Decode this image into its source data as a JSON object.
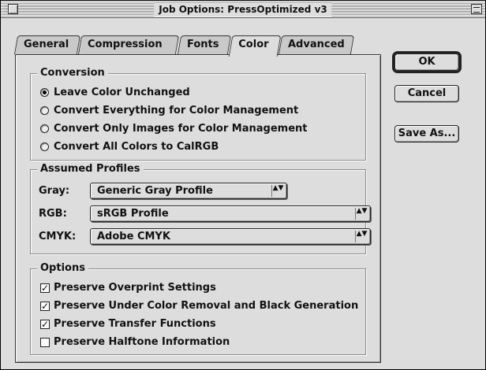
{
  "window": {
    "title": "Job Options: PressOptimized v3"
  },
  "tabs": [
    {
      "label": "General"
    },
    {
      "label": "Compression"
    },
    {
      "label": "Fonts"
    },
    {
      "label": "Color"
    },
    {
      "label": "Advanced"
    }
  ],
  "active_tab": "Color",
  "conversion": {
    "title": "Conversion",
    "options": [
      {
        "label": "Leave Color Unchanged",
        "selected": true
      },
      {
        "label": "Convert Everything for Color Management",
        "selected": false
      },
      {
        "label": "Convert Only Images for Color Management",
        "selected": false
      },
      {
        "label": "Convert All Colors to CalRGB",
        "selected": false
      }
    ]
  },
  "profiles": {
    "title": "Assumed Profiles",
    "gray": {
      "label": "Gray:",
      "value": "Generic Gray Profile"
    },
    "rgb": {
      "label": "RGB:",
      "value": "sRGB Profile"
    },
    "cmyk": {
      "label": "CMYK:",
      "value": "Adobe CMYK"
    }
  },
  "options": {
    "title": "Options",
    "items": [
      {
        "label": "Preserve Overprint Settings",
        "checked": true
      },
      {
        "label": "Preserve Under Color Removal and Black Generation",
        "checked": true
      },
      {
        "label": "Preserve Transfer Functions",
        "checked": true
      },
      {
        "label": "Preserve Halftone Information",
        "checked": false
      }
    ]
  },
  "buttons": {
    "ok": "OK",
    "cancel": "Cancel",
    "save_as": "Save As..."
  },
  "glyphs": {
    "check": "✓",
    "popup_arrows": "▲▼"
  }
}
